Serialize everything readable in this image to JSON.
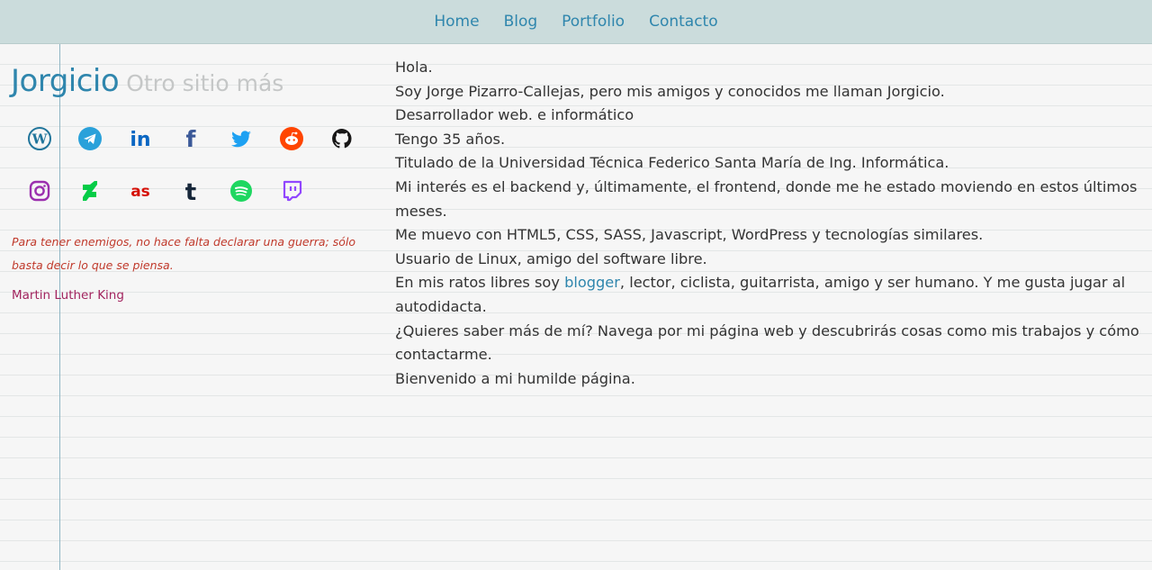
{
  "nav": {
    "items": [
      {
        "label": "Home"
      },
      {
        "label": "Blog"
      },
      {
        "label": "Portfolio"
      },
      {
        "label": "Contacto"
      }
    ]
  },
  "brand": {
    "name": "Jorgicio",
    "tagline": "Otro sitio más"
  },
  "social": {
    "row1": [
      {
        "icon": "wordpress-icon",
        "color": "#21759b"
      },
      {
        "icon": "telegram-icon",
        "color": "#2aa1da"
      },
      {
        "icon": "linkedin-icon",
        "color": "#0a66c2"
      },
      {
        "icon": "facebook-icon",
        "color": "#3b5998"
      },
      {
        "icon": "twitter-icon",
        "color": "#1da1f2"
      },
      {
        "icon": "reddit-icon",
        "color": "#ff4500"
      },
      {
        "icon": "github-icon",
        "color": "#181717"
      }
    ],
    "row2": [
      {
        "icon": "instagram-icon",
        "color": "#9b2fae"
      },
      {
        "icon": "deviantart-icon",
        "color": "#05cc47"
      },
      {
        "icon": "lastfm-icon",
        "color": "#d51007"
      },
      {
        "icon": "tumblr-icon",
        "color": "#17273a"
      },
      {
        "icon": "spotify-icon",
        "color": "#1ed760"
      },
      {
        "icon": "twitch-icon",
        "color": "#9146ff"
      }
    ]
  },
  "quote": {
    "text": "Para tener enemigos, no hace falta declarar una guerra; sólo basta decir lo que se piensa.",
    "author": "Martin Luther King"
  },
  "content": {
    "line1": "Hola.",
    "line2": "Soy Jorge Pizarro-Callejas, pero mis amigos y conocidos me llaman Jorgicio.",
    "line3": "Desarrollador web. e informático",
    "line4": "Tengo 35 años.",
    "line5": "Titulado de la Universidad Técnica Federico Santa María de Ing. Informática.",
    "line6": "Mi interés es el backend y, últimamente, el frontend, donde me he estado moviendo en estos últimos meses.",
    "line7": "Me muevo con HTML5, CSS, SASS, Javascript, WordPress y tecnologías similares.",
    "line8": "Usuario de Linux, amigo del software libre.",
    "line9_before": "En mis ratos libres soy ",
    "line9_link": "blogger",
    "line9_after": ", lector, ciclista, guitarrista, amigo y ser humano. Y me gusta jugar al autodidacta.",
    "line10": "¿Quieres saber más de mí? Navega por mi página web y descubrirás cosas como mis trabajos y cómo contactarme.",
    "line11": "Bienvenido a mi humilde página."
  }
}
